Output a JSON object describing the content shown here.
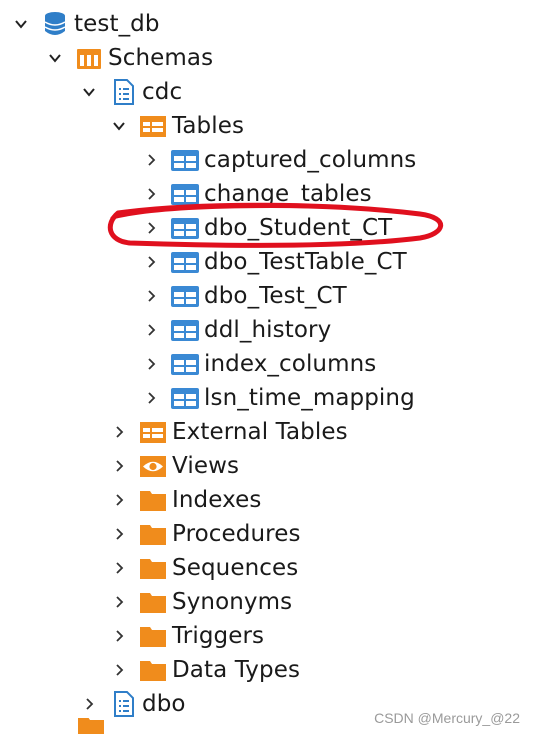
{
  "tree": {
    "db": "test_db",
    "schemas": "Schemas",
    "cdc": "cdc",
    "tables": "Tables",
    "cdc_tables": [
      "captured_columns",
      "change_tables",
      "dbo_Student_CT",
      "dbo_TestTable_CT",
      "dbo_Test_CT",
      "ddl_history",
      "index_columns",
      "lsn_time_mapping"
    ],
    "external_tables": "External Tables",
    "views": "Views",
    "folders": [
      "Indexes",
      "Procedures",
      "Sequences",
      "Synonyms",
      "Triggers",
      "Data Types"
    ],
    "dbo": "dbo"
  },
  "watermark": "CSDN @Mercury_@22",
  "colors": {
    "db_icon": "#2f7ec8",
    "folder": "#f08c1c",
    "table_icon": "#3a89d4",
    "annotation": "#e0101e"
  }
}
